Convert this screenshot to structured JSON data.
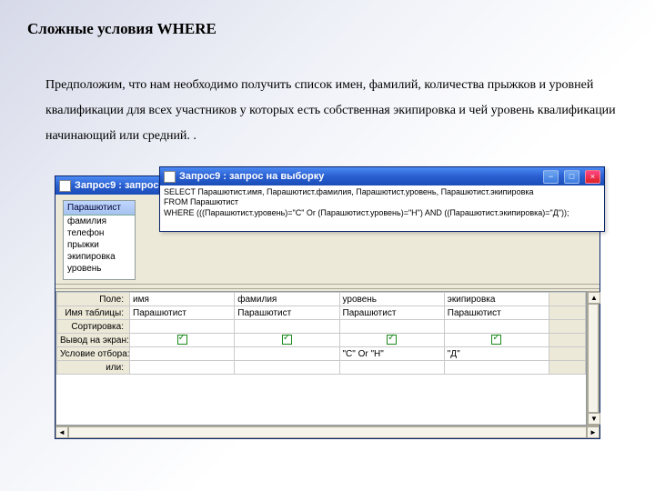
{
  "page": {
    "title": "Сложные условия WHERE",
    "body": "Предположим, что нам необходимо получить список имен, фамилий, количества прыжков и уровней квалификации для всех участников у которых есть собственная экипировка и чей уровень квалификации  начинающий или средний. ."
  },
  "back_win": {
    "title": "Запрос9 : запрос на выборку",
    "fields_header": "Парашютист",
    "fields": [
      "фамилия",
      "телефон",
      "прыжки",
      "экипировка",
      "уровень"
    ],
    "qbe_rows": [
      "Поле:",
      "Имя таблицы:",
      "Сортировка:",
      "Вывод на экран:",
      "Условие отбора:",
      "или:"
    ],
    "cols": [
      {
        "field": "имя",
        "table": "Парашютист",
        "criteria": ""
      },
      {
        "field": "фамилия",
        "table": "Парашютист",
        "criteria": ""
      },
      {
        "field": "уровень",
        "table": "Парашютист",
        "criteria": "\"С\" Or \"Н\""
      },
      {
        "field": "экипировка",
        "table": "Парашютист",
        "criteria": "\"Д\""
      }
    ]
  },
  "front_win": {
    "title": "Запрос9 : запрос на выборку",
    "sql": "SELECT Парашютист.имя, Парашютист.фамилия, Парашютист.уровень, Парашютист.экипировка\nFROM Парашютист\nWHERE (((Парашютист.уровень)=\"С\" Or (Парашютист.уровень)=\"Н\") AND ((Парашютист.экипировка)=\"Д\"));"
  },
  "win_buttons": {
    "min": "−",
    "max": "□",
    "close": "×"
  },
  "scroll": {
    "left": "◄",
    "right": "►",
    "up": "▲",
    "down": "▼"
  }
}
